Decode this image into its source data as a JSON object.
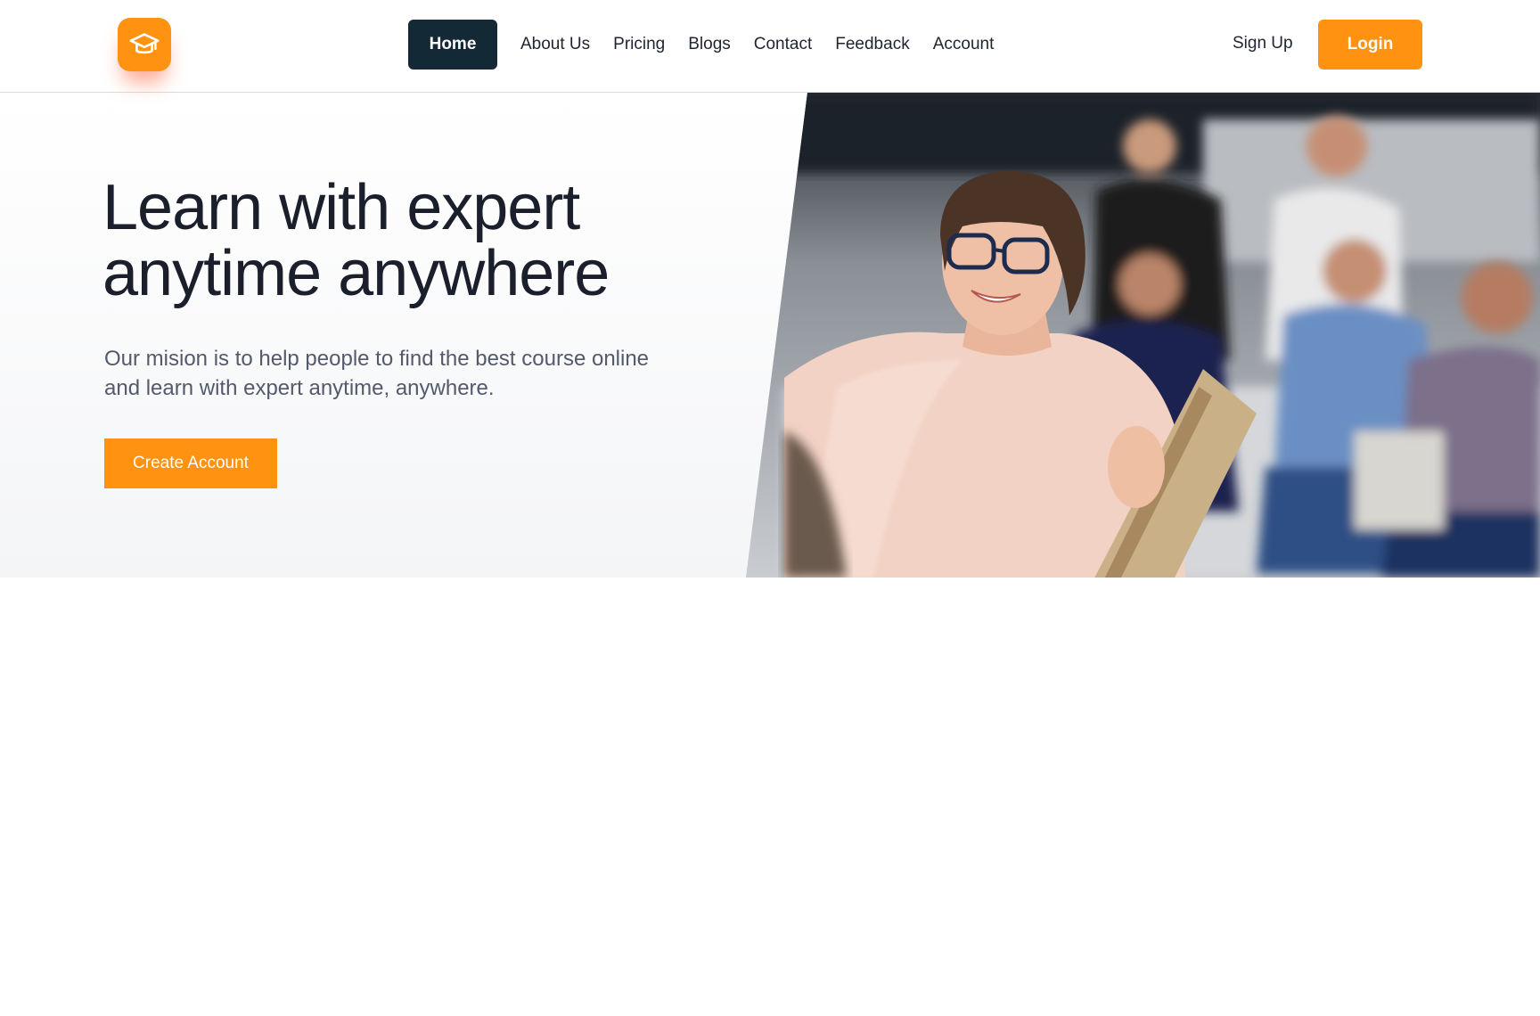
{
  "brand": {
    "logo_icon": "graduation-cap-icon",
    "accent_color": "#ff9210",
    "dark_color": "#132a36"
  },
  "nav": {
    "items": [
      {
        "label": "Home",
        "active": true
      },
      {
        "label": "About Us"
      },
      {
        "label": "Pricing"
      },
      {
        "label": "Blogs"
      },
      {
        "label": "Contact"
      },
      {
        "label": "Feedback"
      },
      {
        "label": "Account"
      }
    ]
  },
  "auth": {
    "signup_label": "Sign Up",
    "login_label": "Login"
  },
  "hero": {
    "headline_line1": "Learn with expert",
    "headline_line2": "anytime anywhere",
    "subtext_line1": "Our mision is to help people to find the best course online",
    "subtext_line2": "and learn with expert anytime, anywhere.",
    "cta_label": "Create Account",
    "image": "classroom-teacher-photo"
  }
}
